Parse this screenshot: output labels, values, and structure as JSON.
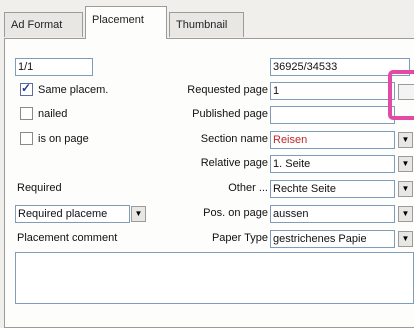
{
  "tabs": [
    "Ad Format",
    "Placement",
    "Thumbnail"
  ],
  "fields": {
    "top_left": "1/1",
    "top_right": "36925/34533",
    "requested_page": "1",
    "published_page": "",
    "section_name": "Reisen",
    "relative_page": "1. Seite",
    "other": "Rechte Seite",
    "required_select": "Required placeme",
    "pos_on_page": "aussen",
    "paper_type": "gestrichenes Papie",
    "comment": ""
  },
  "checkboxes": {
    "same_placement": {
      "label": "Same placem.",
      "checked": true
    },
    "nailed": {
      "label": "nailed",
      "checked": false
    },
    "is_on_page": {
      "label": "is on page",
      "checked": false
    }
  },
  "labels": {
    "requested_page": "Requested page",
    "published_page": "Published page",
    "section_name": "Section name",
    "relative_page": "Relative page",
    "required": "Required",
    "other": "Other ...",
    "pos_on_page": "Pos. on page",
    "placement_comment": "Placement comment",
    "paper_type": "Paper Type"
  },
  "dropdown_arrow": "▼",
  "colors": {
    "highlight": "#e34aa6",
    "section_value": "#c0282b"
  }
}
